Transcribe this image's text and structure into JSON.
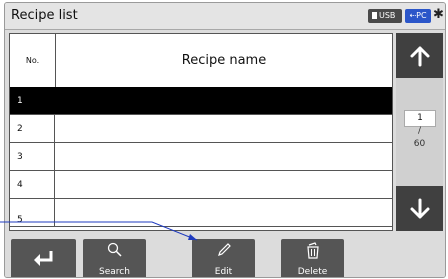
{
  "header": {
    "title": "Recipe list",
    "usb_label": "USB",
    "pc_label": "PC",
    "bluetooth_glyph": "✱"
  },
  "table": {
    "columns": {
      "no": "No.",
      "name": "Recipe name"
    },
    "rows": [
      {
        "no": "1",
        "name": "",
        "selected": true
      },
      {
        "no": "2",
        "name": ""
      },
      {
        "no": "3",
        "name": ""
      },
      {
        "no": "4",
        "name": ""
      },
      {
        "no": "5",
        "name": ""
      }
    ]
  },
  "pager": {
    "current": "1",
    "separator": "/",
    "total": "60"
  },
  "toolbar": {
    "back_label": "",
    "search_label": "Search",
    "edit_label": "Edit",
    "delete_label": "Delete"
  },
  "colors": {
    "button_dark": "#555555",
    "selected_row": "#000000",
    "pc_badge": "#2b56c9",
    "callout_line": "#1f3bbf"
  }
}
